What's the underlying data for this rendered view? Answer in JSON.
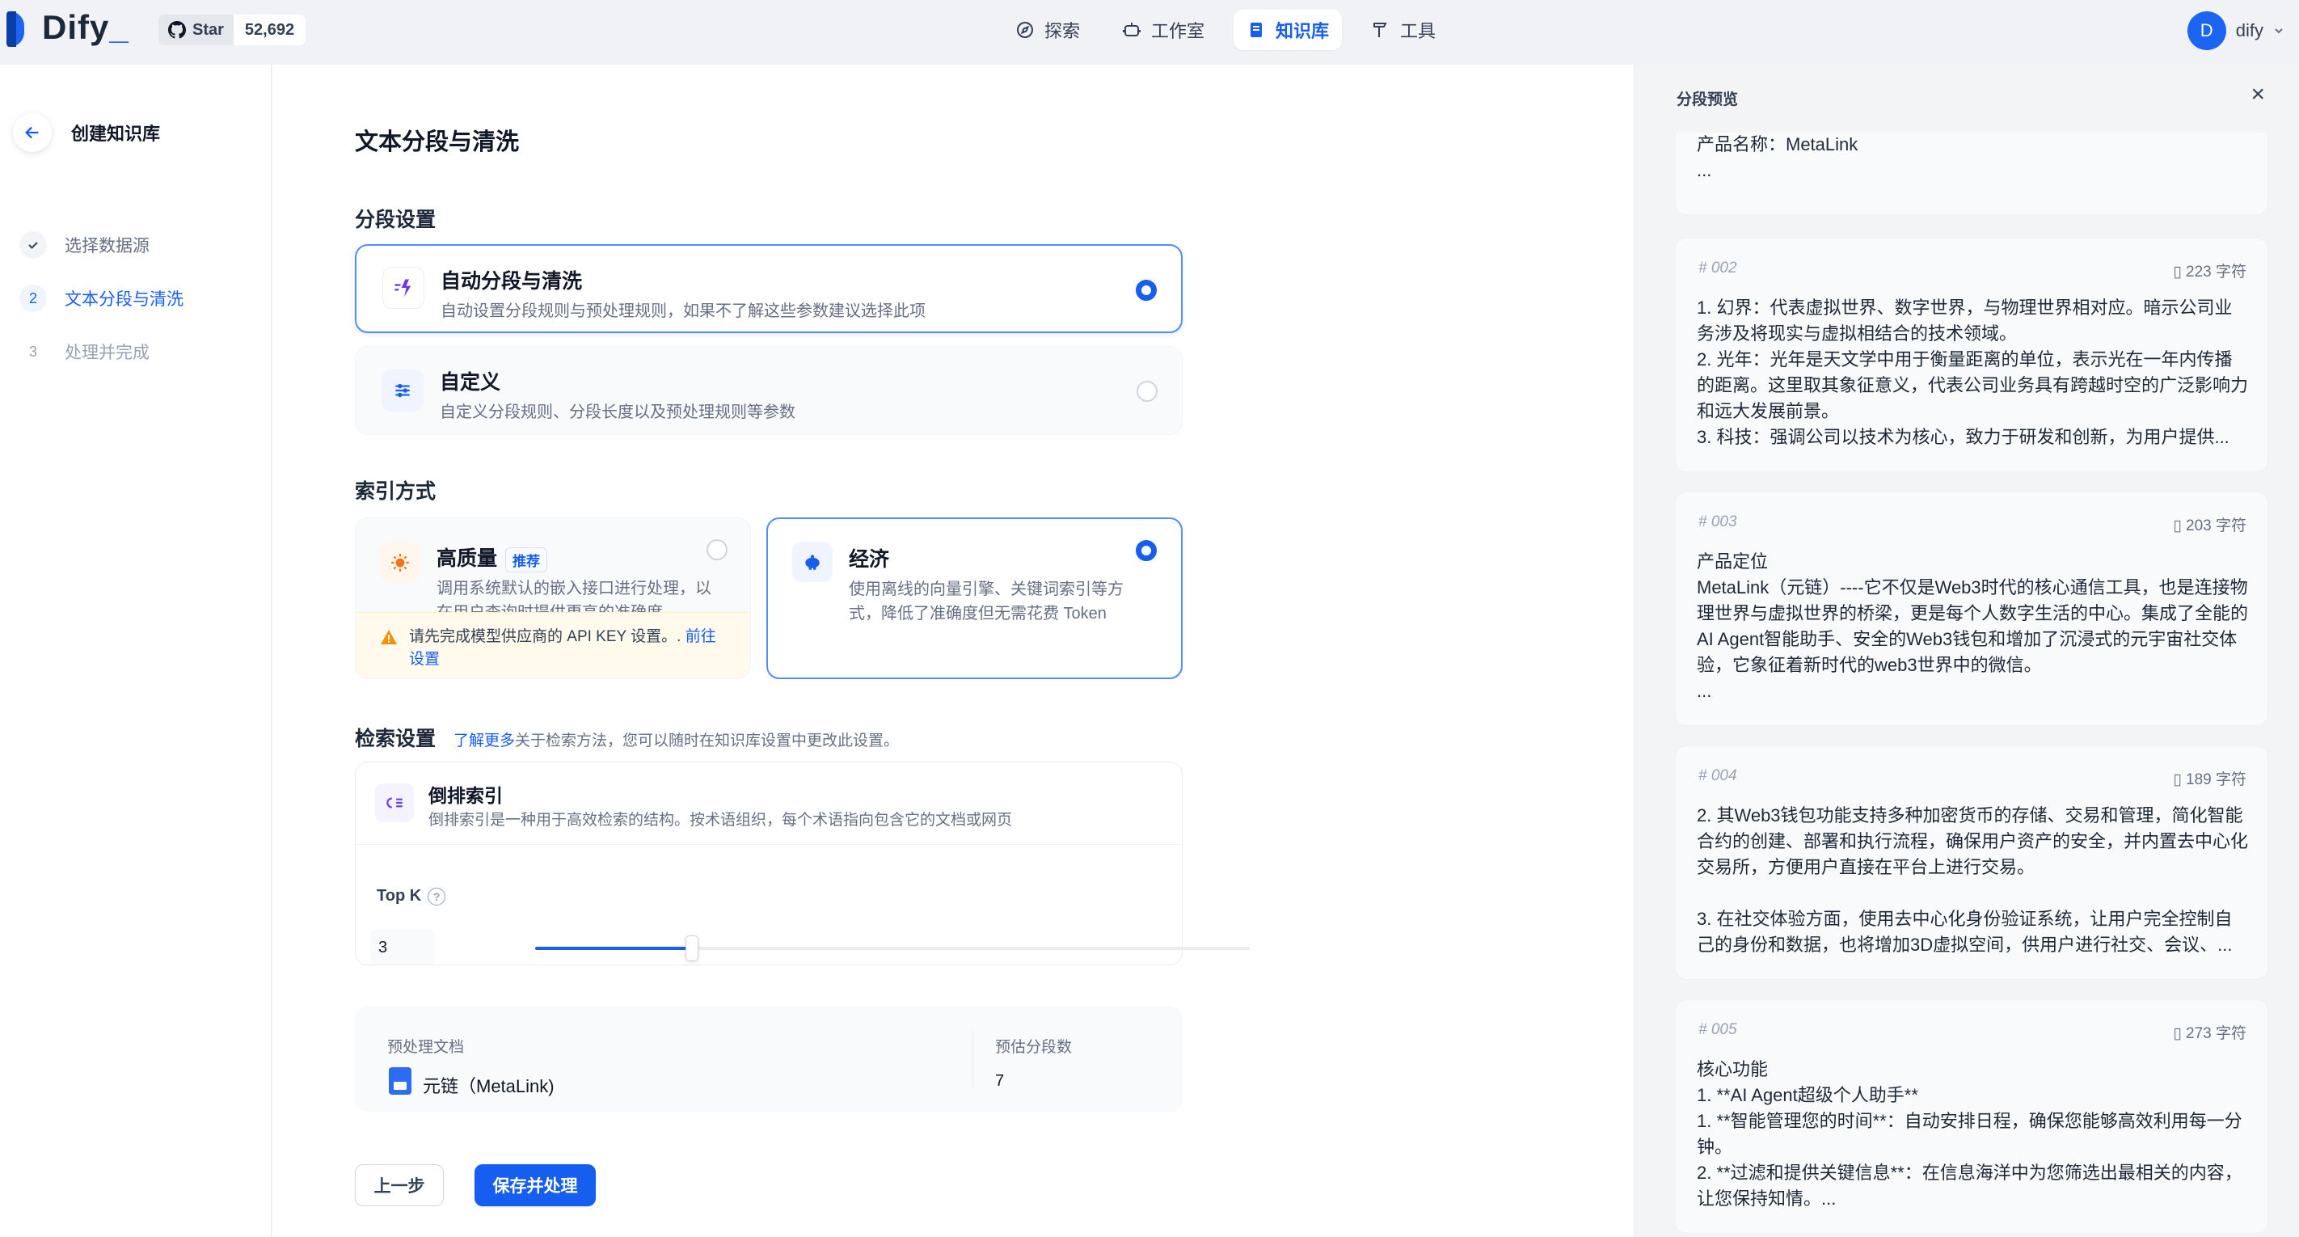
{
  "header": {
    "logo_text": "Dify",
    "github_star": "Star",
    "github_count": "52,692",
    "nav": [
      {
        "label": "探索",
        "icon": "compass-icon",
        "active": false
      },
      {
        "label": "工作室",
        "icon": "robot-icon",
        "active": false
      },
      {
        "label": "知识库",
        "icon": "book-icon",
        "active": true
      },
      {
        "label": "工具",
        "icon": "hammer-icon",
        "active": false
      }
    ],
    "user_initial": "D",
    "user_name": "dify"
  },
  "sidebar": {
    "title": "创建知识库",
    "steps": [
      {
        "num": "✓",
        "label": "选择数据源",
        "state": "done"
      },
      {
        "num": "2",
        "label": "文本分段与清洗",
        "state": "active"
      },
      {
        "num": "3",
        "label": "处理并完成",
        "state": "pending"
      }
    ]
  },
  "main": {
    "title": "文本分段与清洗",
    "segment_section": "分段设置",
    "auto_option": {
      "title": "自动分段与清洗",
      "desc": "自动设置分段规则与预处理规则，如果不了解这些参数建议选择此项"
    },
    "custom_option": {
      "title": "自定义",
      "desc": "自定义分段规则、分段长度以及预处理规则等参数"
    },
    "index_section": "索引方式",
    "high_quality": {
      "title": "高质量",
      "badge": "推荐",
      "desc": "调用系统默认的嵌入接口进行处理，以在用户查询时提供更高的准确度",
      "warning": "请先完成模型供应商的 API KEY 设置。. ",
      "warning_link": "前往设置"
    },
    "economy": {
      "title": "经济",
      "desc": "使用离线的向量引擎、关键词索引等方式，降低了准确度但无需花费 Token"
    },
    "retrieval": {
      "title": "检索设置",
      "learn_more": "了解更多",
      "desc": "关于检索方法，您可以随时在知识库设置中更改此设置。",
      "method_title": "倒排索引",
      "method_desc": "倒排索引是一种用于高效检索的结构。按术语组织，每个术语指向包含它的文档或网页",
      "topk_label": "Top K",
      "topk_value": "3",
      "topk_fraction": 0.22
    },
    "summary": {
      "doc_label": "预处理文档",
      "doc_name": "元链（MetaLink)",
      "count_label": "预估分段数",
      "count_value": "7"
    },
    "buttons": {
      "prev": "上一步",
      "save": "保存并处理"
    }
  },
  "preview": {
    "title": "分段预览",
    "chunks": [
      {
        "id": "",
        "chars": "",
        "text": "产品名称：MetaLink\n..."
      },
      {
        "id": "002",
        "chars": "223 字符",
        "text": "1. 幻界：代表虚拟世界、数字世界，与物理世界相对应。暗示公司业务涉及将现实与虚拟相结合的技术领域。\n2. 光年：光年是天文学中用于衡量距离的单位，表示光在一年内传播的距离。这里取其象征意义，代表公司业务具有跨越时空的广泛影响力和远大发展前景。\n3. 科技：强调公司以技术为核心，致力于研发和创新，为用户提供..."
      },
      {
        "id": "003",
        "chars": "203 字符",
        "text": "产品定位\nMetaLink（元链）----它不仅是Web3时代的核心通信工具，也是连接物理世界与虚拟世界的桥梁，更是每个人数字生活的中心。集成了全能的AI Agent智能助手、安全的Web3钱包和增加了沉浸式的元宇宙社交体验，它象征着新时代的web3世界中的微信。\n..."
      },
      {
        "id": "004",
        "chars": "189 字符",
        "text": "2. 其Web3钱包功能支持多种加密货币的存储、交易和管理，简化智能合约的创建、部署和执行流程，确保用户资产的安全，并内置去中心化交易所，方便用户直接在平台上进行交易。\n\n3. 在社交体验方面，使用去中心化身份验证系统，让用户完全控制自己的身份和数据，也将增加3D虚拟空间，供用户进行社交、会议、..."
      },
      {
        "id": "005",
        "chars": "273 字符",
        "text": "核心功能\n1. **AI Agent超级个人助手**\n1. **智能管理您的时间**：自动安排日程，确保您能够高效利用每一分钟。\n2. **过滤和提供关键信息**：在信息海洋中为您筛选出最相关的内容，让您保持知情。..."
      }
    ]
  },
  "colors": {
    "accent": "#155eef",
    "warning_bg": "#fffaeb"
  }
}
